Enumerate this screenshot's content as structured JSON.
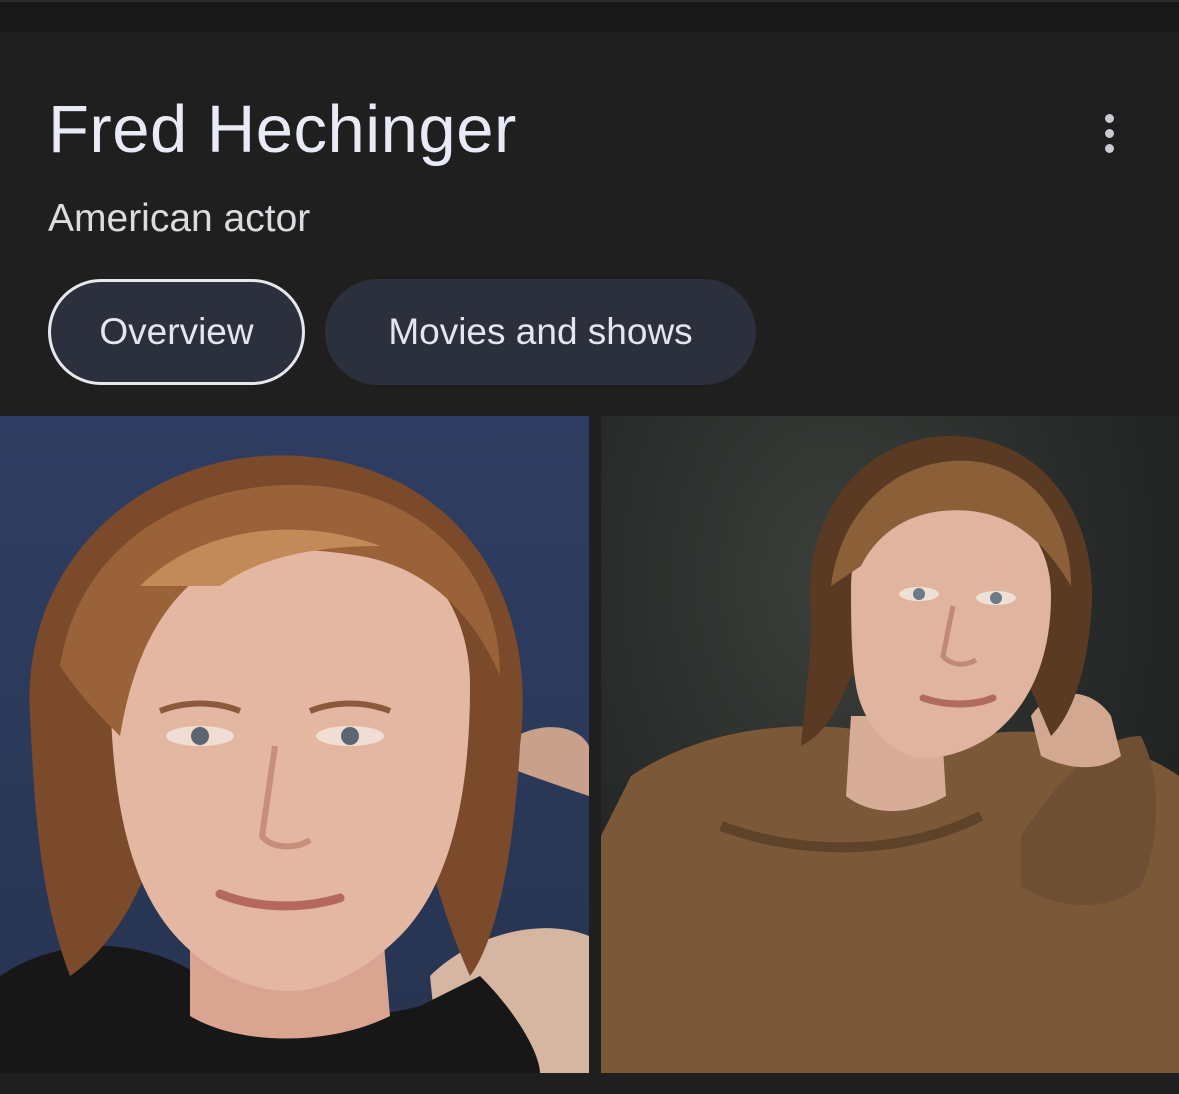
{
  "knowledge_panel": {
    "title": "Fred Hechinger",
    "subtitle": "American actor",
    "more_icon": "more-vert-icon",
    "tabs": [
      {
        "label": "Overview",
        "selected": true
      },
      {
        "label": "Movies and shows",
        "selected": false
      }
    ],
    "images": [
      {
        "subject": "portrait-photo"
      },
      {
        "subject": "portrait-photo"
      }
    ]
  },
  "colors": {
    "background": "#1f1f1f",
    "title_text": "#e8eaf6",
    "chip_background": "#2b303c",
    "chip_selected_border": "#e6e8ee"
  }
}
